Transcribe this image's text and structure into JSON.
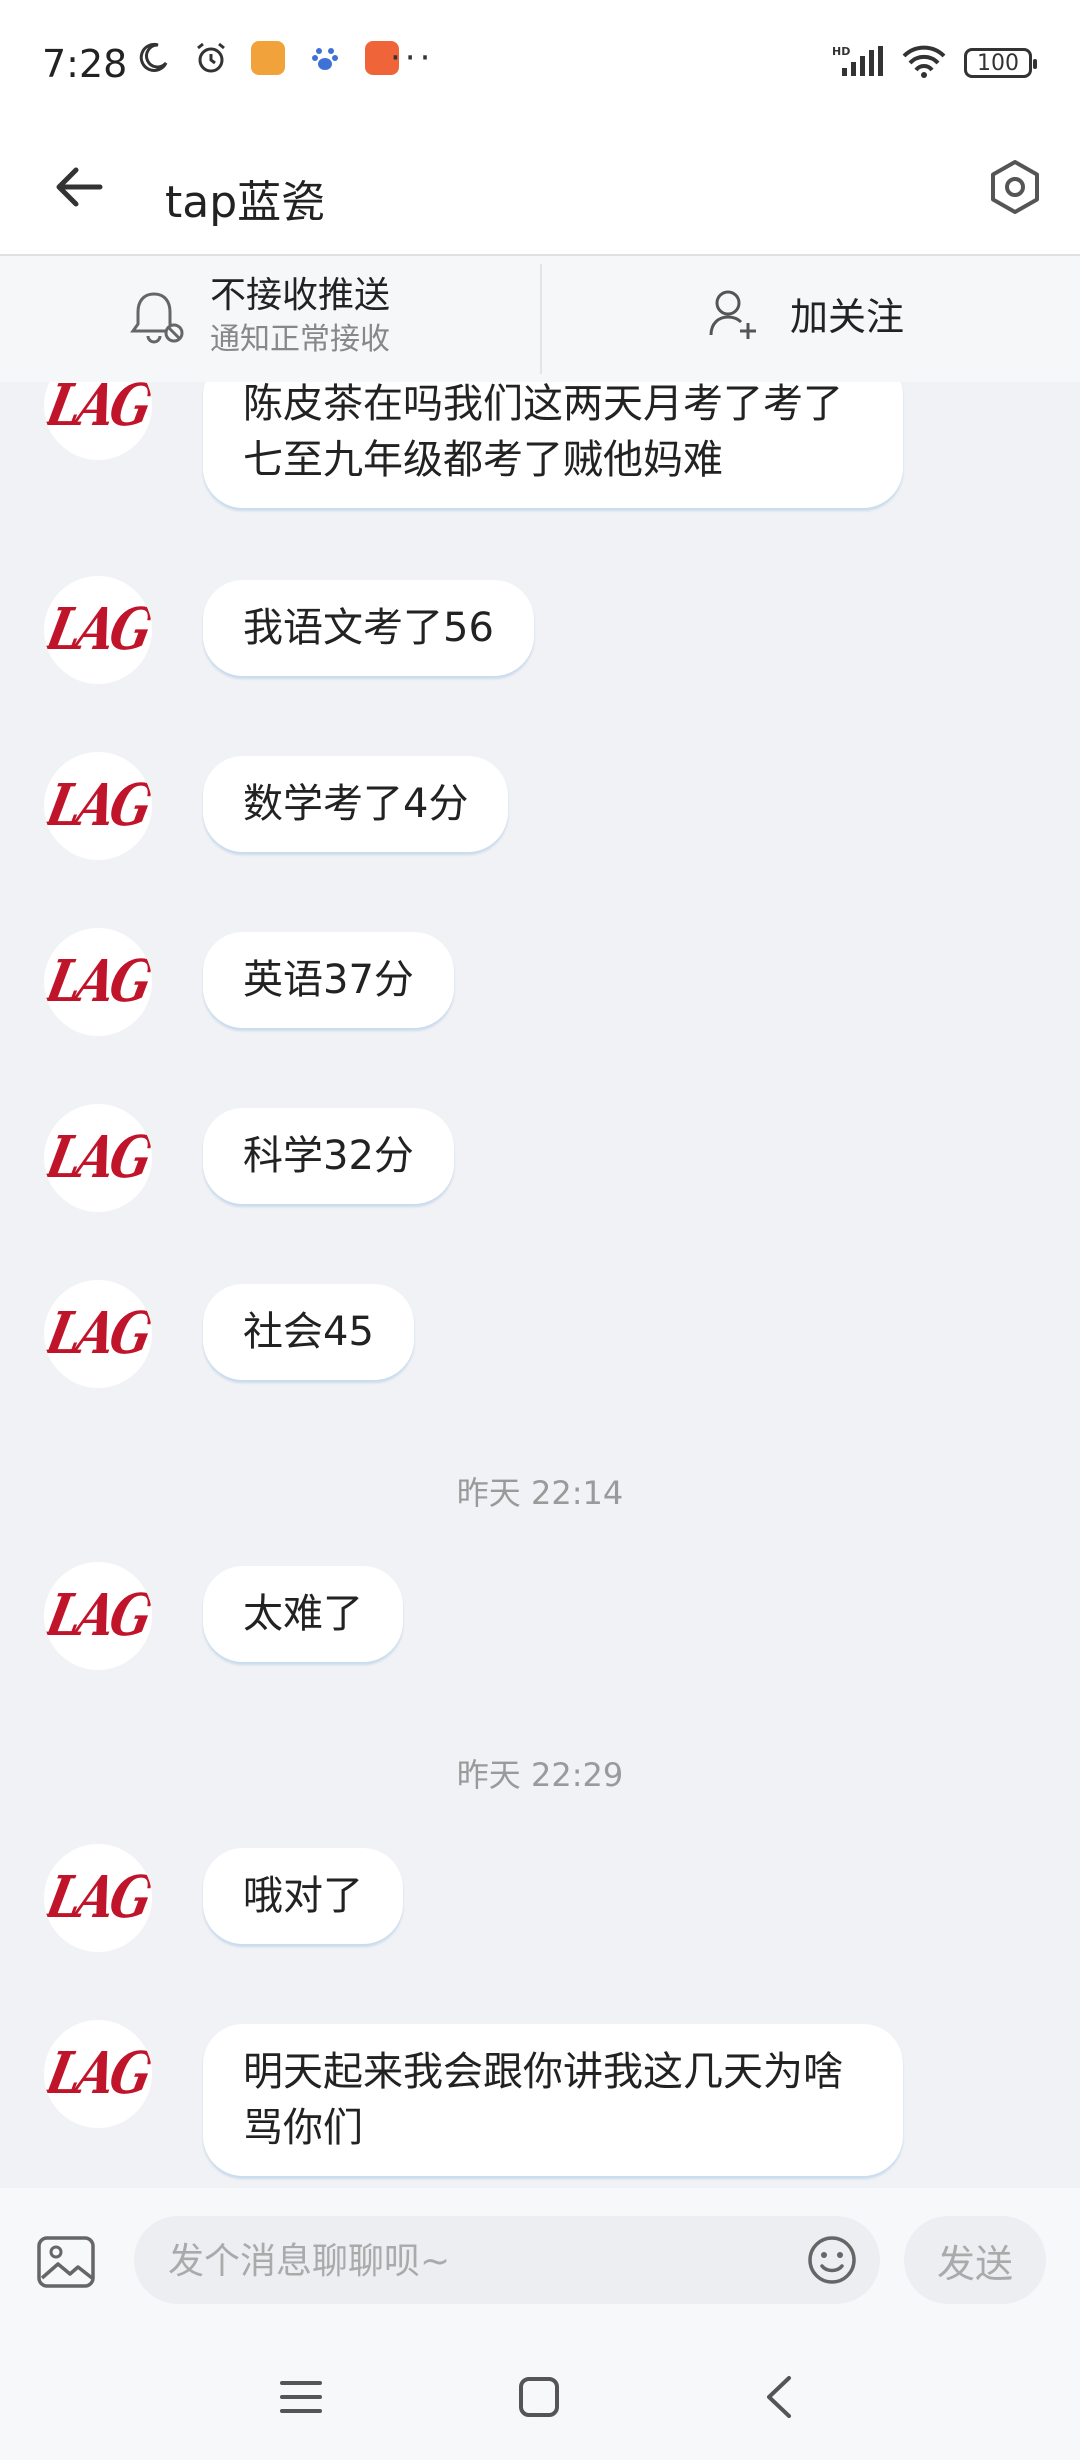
{
  "status_bar": {
    "time": "7:28",
    "battery": "100",
    "more": "···",
    "icons": [
      "moon-icon",
      "alarm-icon",
      "app-icon-orange",
      "paw-icon",
      "app-icon-red",
      "hd-signal-icon",
      "wifi-icon",
      "battery-icon"
    ]
  },
  "header": {
    "title": "tap蓝瓷",
    "back_icon": "arrow-left-icon",
    "settings_icon": "hexagon-settings-icon"
  },
  "subbar": {
    "push_title": "不接收推送",
    "push_sub": "通知正常接收",
    "follow_label": "加关注"
  },
  "messages": [
    {
      "type": "msg",
      "avatar": "LAG",
      "text": "陈皮茶在吗我们这两天月考了考了七至九年级都考了贼他妈难"
    },
    {
      "type": "msg",
      "avatar": "LAG",
      "text": "我语文考了56"
    },
    {
      "type": "msg",
      "avatar": "LAG",
      "text": "数学考了4分"
    },
    {
      "type": "msg",
      "avatar": "LAG",
      "text": "英语37分"
    },
    {
      "type": "msg",
      "avatar": "LAG",
      "text": "科学32分"
    },
    {
      "type": "msg",
      "avatar": "LAG",
      "text": "社会45"
    },
    {
      "type": "time",
      "text": "昨天 22:14"
    },
    {
      "type": "msg",
      "avatar": "LAG",
      "text": "太难了"
    },
    {
      "type": "time",
      "text": "昨天 22:29"
    },
    {
      "type": "msg",
      "avatar": "LAG",
      "text": "哦对了"
    },
    {
      "type": "msg",
      "avatar": "LAG",
      "text": "明天起来我会跟你讲我这几天为啥骂你们"
    }
  ],
  "composer": {
    "placeholder": "发个消息聊聊呗~",
    "value": "",
    "send_label": "发送"
  },
  "colors": {
    "avatar_red": "#c0142a",
    "page_bg": "#f1f2f5",
    "bubble_shadow": "#aac8e6"
  }
}
